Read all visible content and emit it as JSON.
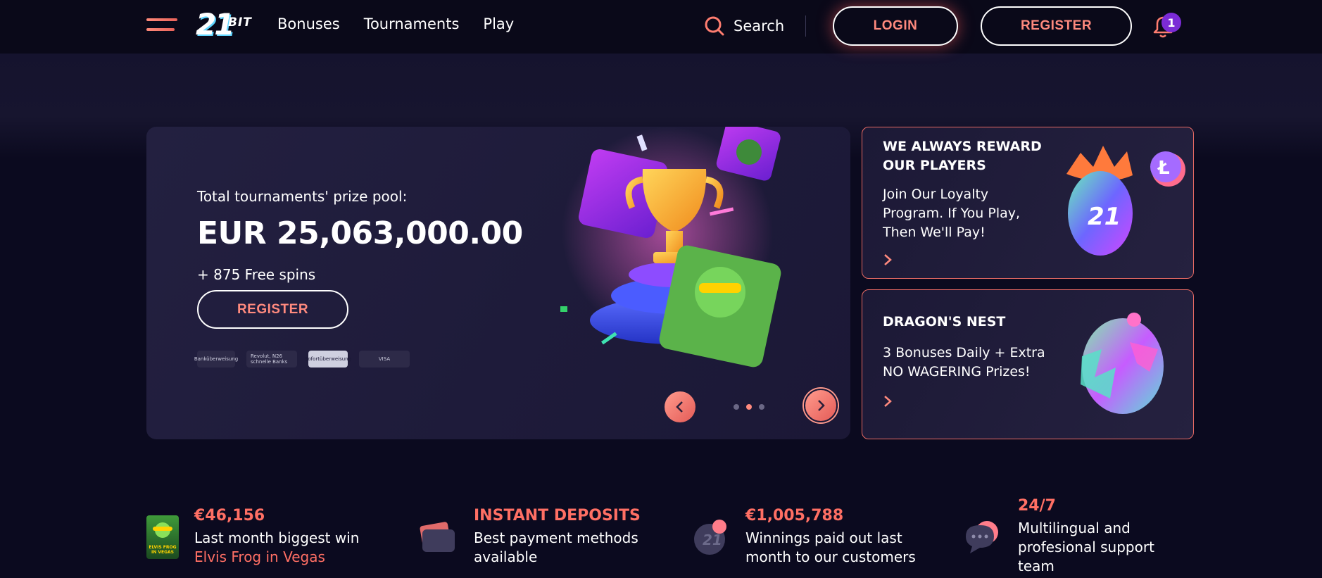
{
  "header": {
    "logo_number": "21",
    "logo_suffix": "BIT",
    "nav": [
      "Bonuses",
      "Tournaments",
      "Play"
    ],
    "search_label": "Search",
    "login_label": "LOGIN",
    "register_label": "REGISTER",
    "notification_count": "1"
  },
  "hero": {
    "pool_label": "Total tournaments' prize pool:",
    "pool_amount": "EUR 25,063,000.00",
    "spins": "+ 875 Free spins",
    "register_label": "REGISTER",
    "payment_methods": [
      "Banküberweisung",
      "Revolut, N26 schnelle Banks",
      "Sofortüberweisung",
      "VISA"
    ],
    "slides_total": 3,
    "active_slide": 2
  },
  "cards": [
    {
      "title_line1": "WE ALWAYS REWARD",
      "title_line2": "OUR PLAYERS",
      "desc_line1": "Join Our Loyalty",
      "desc_line2": "Program. If You Play,",
      "desc_line3": "Then We'll Pay!"
    },
    {
      "title_line1": "DRAGON'S NEST",
      "desc_line1": "3 Bonuses Daily + Extra",
      "desc_line2": "NO WAGERING Prizes!"
    }
  ],
  "features": [
    {
      "amount": "€46,156",
      "line1": "Last month biggest win",
      "link": "Elvis Frog in Vegas",
      "thumb_line1": "ELVIS FROG",
      "thumb_line2": "IN VEGAS"
    },
    {
      "amount": "INSTANT DEPOSITS",
      "line1": "Best payment methods",
      "line2": "available"
    },
    {
      "amount": "€1,005,788",
      "line1": "Winnings paid out last",
      "line2": "month to our customers"
    },
    {
      "amount": "24/7",
      "line1": "Multilingual and",
      "line2": "profesional support",
      "line3": "team"
    }
  ],
  "colors": {
    "accent": "#ff8a7e",
    "accent_red": "#ff6f64",
    "background": "#0b0a1f",
    "badge": "#7b2bd6"
  }
}
